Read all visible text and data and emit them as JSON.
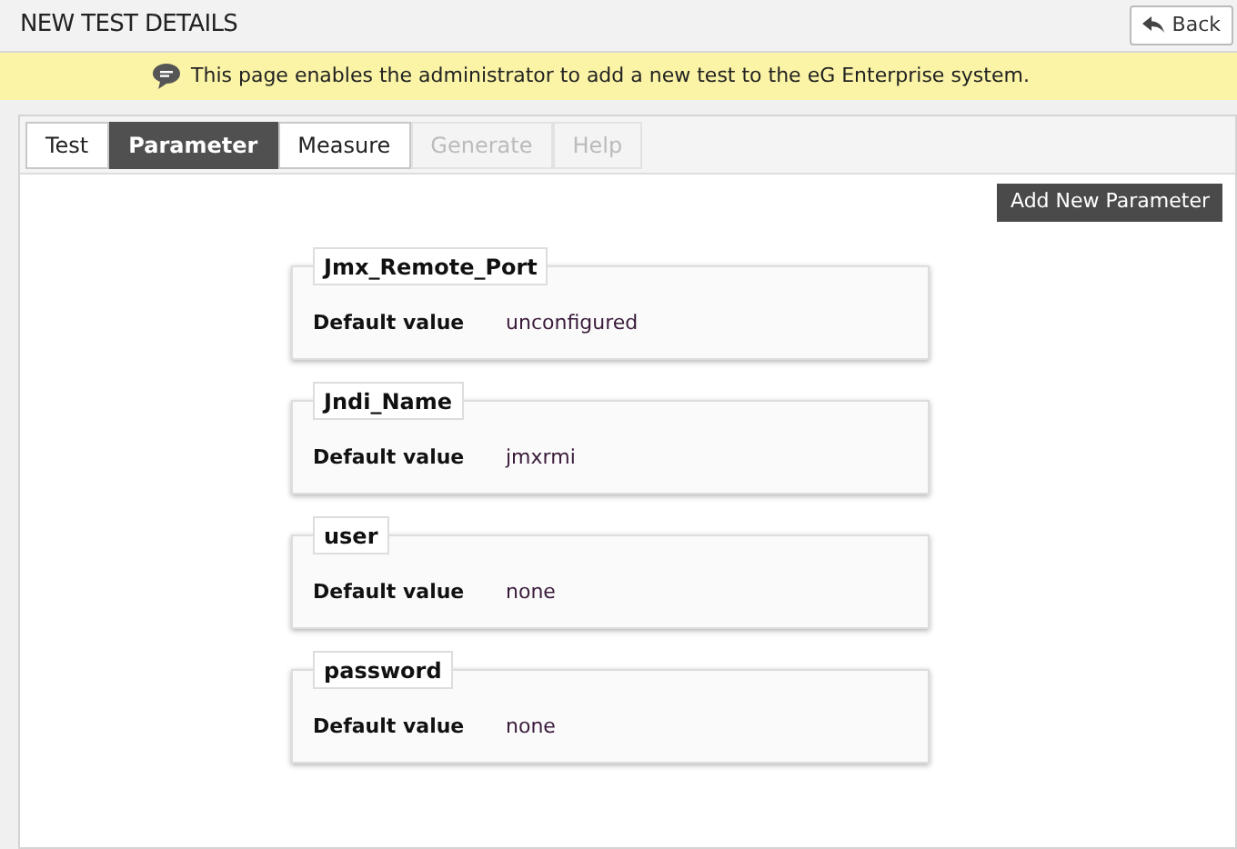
{
  "header": {
    "title": "NEW TEST DETAILS",
    "back_button": "Back"
  },
  "info_bar": {
    "message": "This page enables the administrator to add a new test to the eG Enterprise system."
  },
  "tabs": [
    {
      "label": "Test",
      "selected": false,
      "disabled": false
    },
    {
      "label": "Parameter",
      "selected": true,
      "disabled": false
    },
    {
      "label": "Measure",
      "selected": false,
      "disabled": false
    },
    {
      "label": "Generate",
      "selected": false,
      "disabled": true
    },
    {
      "label": "Help",
      "selected": false,
      "disabled": true
    }
  ],
  "add_button": "Add New Parameter",
  "parameters": [
    {
      "name": "Jmx_Remote_Port",
      "label": "Default value",
      "value": "unconfigured"
    },
    {
      "name": "Jndi_Name",
      "label": "Default value",
      "value": "jmxrmi"
    },
    {
      "name": "user",
      "label": "Default value",
      "value": "none"
    },
    {
      "name": "password",
      "label": "Default value",
      "value": "none"
    }
  ]
}
